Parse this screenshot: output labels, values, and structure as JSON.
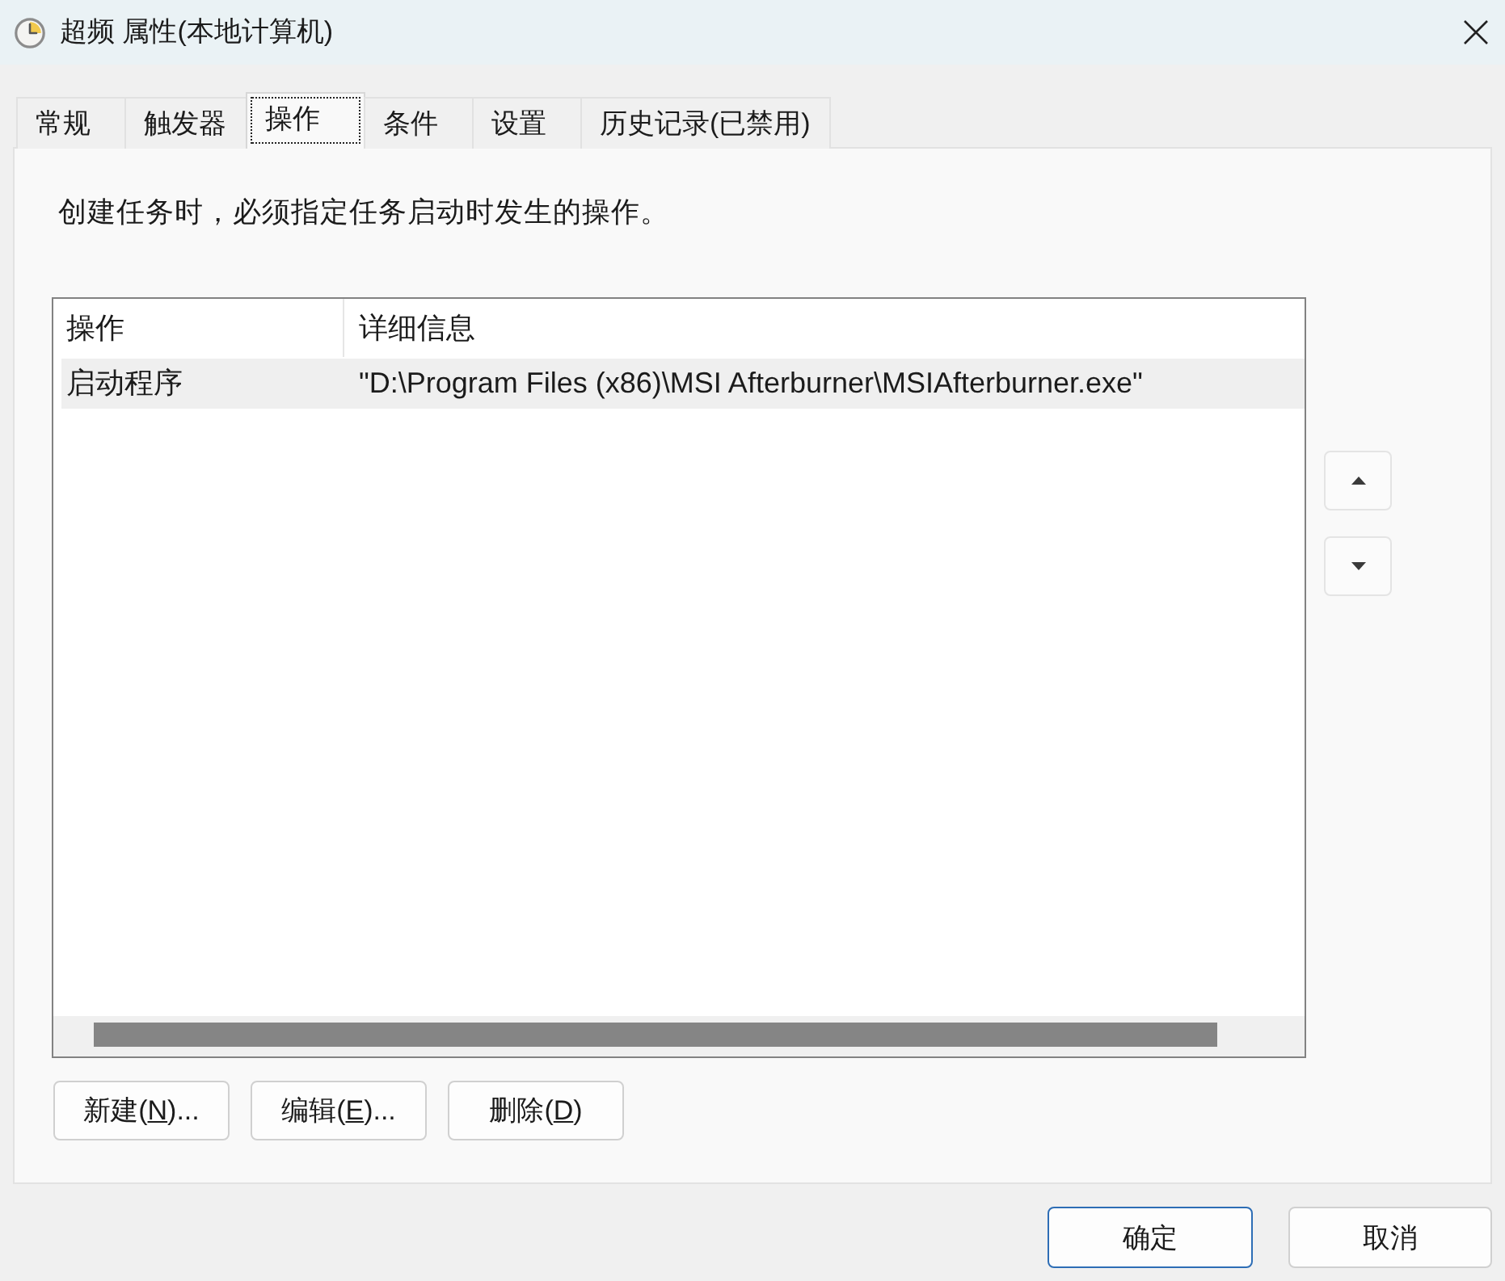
{
  "window": {
    "title": "超频 属性(本地计算机)"
  },
  "tabs": [
    {
      "label": "常规",
      "selected": false
    },
    {
      "label": "触发器",
      "selected": false
    },
    {
      "label": "操作",
      "selected": true
    },
    {
      "label": "条件",
      "selected": false
    },
    {
      "label": "设置",
      "selected": false
    },
    {
      "label": "历史记录(已禁用)",
      "selected": false
    }
  ],
  "description": "创建任务时，必须指定任务启动时发生的操作。",
  "action_list": {
    "columns": [
      "操作",
      "详细信息"
    ],
    "rows": [
      {
        "cells": [
          "启动程序",
          "\"D:\\Program Files (x86)\\MSI Afterburner\\MSIAfterburner.exe\""
        ],
        "selected": true
      }
    ]
  },
  "action_buttons": [
    {
      "text_before": "新建(",
      "access_key": "N",
      "text_after": ")..."
    },
    {
      "text_before": "编辑(",
      "access_key": "E",
      "text_after": ")..."
    },
    {
      "text_before": "删除(",
      "access_key": "D",
      "text_after": ")"
    }
  ],
  "dialog_buttons": [
    {
      "label": "确定",
      "default": true
    },
    {
      "label": "取消",
      "default": false
    }
  ]
}
